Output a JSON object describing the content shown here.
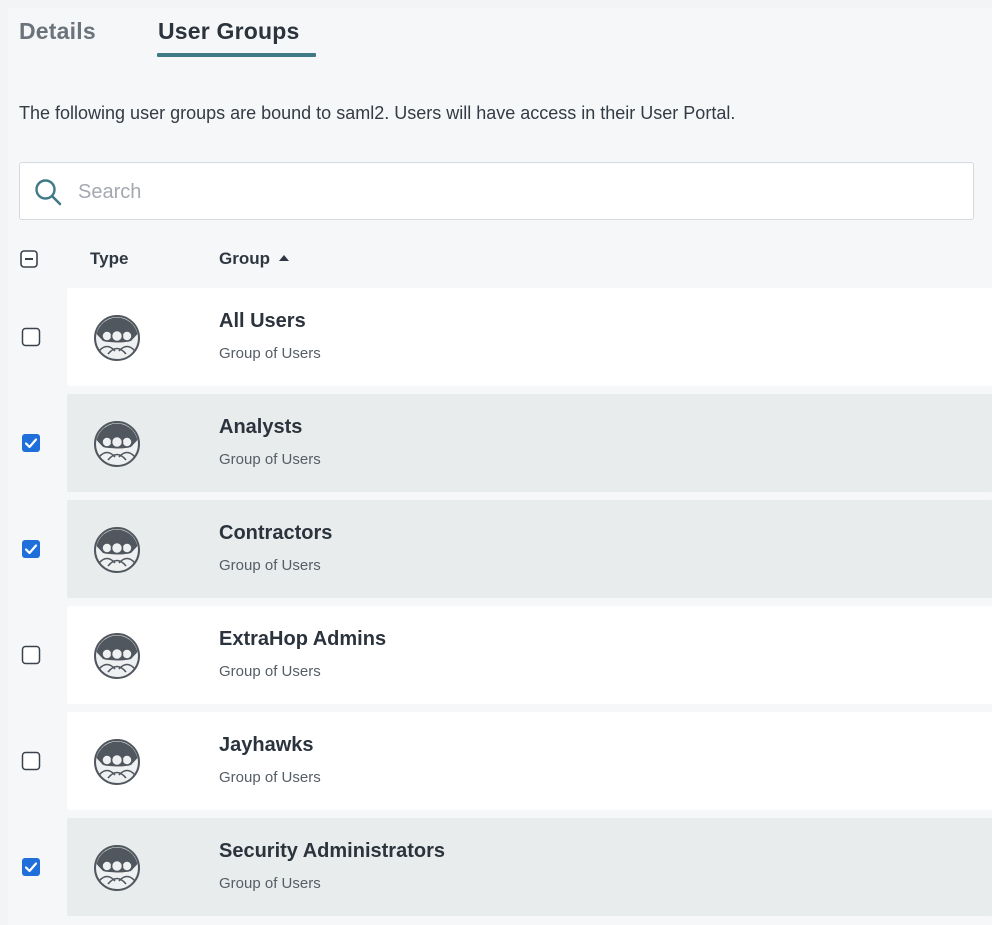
{
  "tabs": [
    {
      "label": "Details",
      "active": false
    },
    {
      "label": "User Groups",
      "active": true
    }
  ],
  "description": "The following user groups are bound to saml2. Users will have access in their User Portal.",
  "search": {
    "placeholder": "Search",
    "value": "",
    "icon": "search-icon"
  },
  "table": {
    "select_all_state": "indeterminate",
    "columns": {
      "type": "Type",
      "group": "Group"
    },
    "sort": {
      "column": "Group",
      "direction": "ascending"
    },
    "rows": [
      {
        "title": "All Users",
        "subtitle": "Group of Users",
        "checked": false,
        "icon": "user-group-icon"
      },
      {
        "title": "Analysts",
        "subtitle": "Group of Users",
        "checked": true,
        "icon": "user-group-icon"
      },
      {
        "title": "Contractors",
        "subtitle": "Group of Users",
        "checked": true,
        "icon": "user-group-icon"
      },
      {
        "title": "ExtraHop Admins",
        "subtitle": "Group of Users",
        "checked": false,
        "icon": "user-group-icon"
      },
      {
        "title": "Jayhawks",
        "subtitle": "Group of Users",
        "checked": false,
        "icon": "user-group-icon"
      },
      {
        "title": "Security Administrators",
        "subtitle": "Group of Users",
        "checked": true,
        "icon": "user-group-icon"
      }
    ]
  },
  "colors": {
    "accent": "#3f7a86",
    "checkbox_checked": "#1e6fd9",
    "row_selected": "#e8ecec",
    "row_unselected": "#ffffff"
  }
}
